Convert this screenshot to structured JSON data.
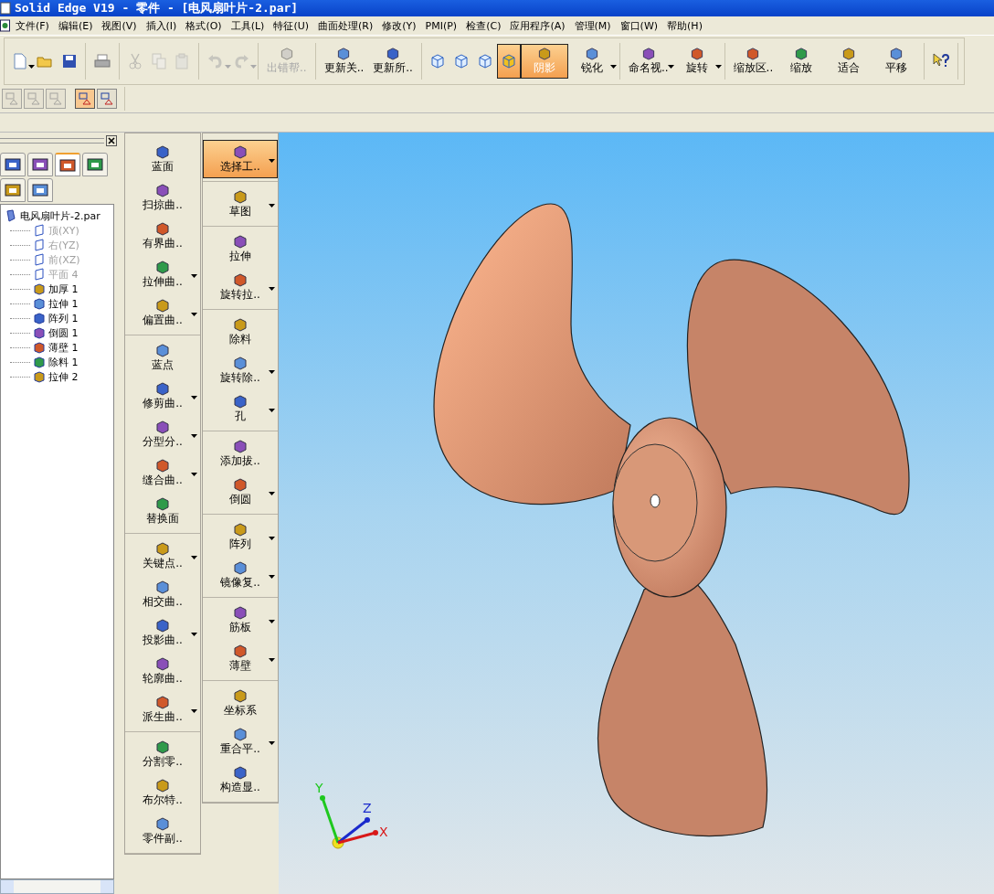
{
  "window": {
    "title": "Solid Edge V19 - 零件 - [电风扇叶片-2.par]"
  },
  "menu": [
    "文件(F)",
    "编辑(E)",
    "视图(V)",
    "插入(I)",
    "格式(O)",
    "工具(L)",
    "特征(U)",
    "曲面处理(R)",
    "修改(Y)",
    "PMI(P)",
    "检查(C)",
    "应用程序(A)",
    "管理(M)",
    "窗口(W)",
    "帮助(H)"
  ],
  "toolbar": [
    [
      {
        "disabled": false,
        "selected": false,
        "dropdown": true
      },
      {
        "disabled": false,
        "selected": false,
        "dropdown": false
      },
      {
        "disabled": false,
        "selected": false,
        "dropdown": false
      }
    ],
    [
      {
        "disabled": false,
        "selected": false,
        "dropdown": false
      }
    ],
    [
      {
        "disabled": true,
        "selected": false,
        "dropdown": false
      },
      {
        "disabled": true,
        "selected": false,
        "dropdown": false
      },
      {
        "disabled": true,
        "selected": false,
        "dropdown": false
      }
    ],
    [
      {
        "disabled": true,
        "selected": false,
        "dropdown": true
      },
      {
        "disabled": true,
        "selected": false,
        "dropdown": true
      }
    ],
    [
      {
        "label": "出错帮..",
        "disabled": true,
        "selected": false,
        "dropdown": false
      }
    ],
    [
      {
        "label": "更新关..",
        "disabled": false,
        "selected": false,
        "dropdown": false
      },
      {
        "label": "更新所..",
        "disabled": false,
        "selected": false,
        "dropdown": false
      }
    ],
    [
      {
        "disabled": false,
        "selected": false,
        "dropdown": false
      },
      {
        "disabled": false,
        "selected": false,
        "dropdown": false
      },
      {
        "disabled": false,
        "selected": false,
        "dropdown": false
      },
      {
        "disabled": false,
        "selected": true,
        "dropdown": false
      },
      {
        "label": "阴影",
        "disabled": false,
        "selected": true,
        "dropdown": false
      },
      {
        "label": "锐化",
        "disabled": false,
        "selected": false,
        "dropdown": true
      }
    ],
    [
      {
        "label": "命名视..",
        "disabled": false,
        "selected": false,
        "dropdown": true
      },
      {
        "label": "旋转",
        "disabled": false,
        "selected": false,
        "dropdown": true
      }
    ],
    [
      {
        "label": "缩放区..",
        "disabled": false,
        "selected": false,
        "dropdown": false
      },
      {
        "label": "缩放",
        "disabled": false,
        "selected": false,
        "dropdown": false
      },
      {
        "label": "适合",
        "disabled": false,
        "selected": false,
        "dropdown": false
      },
      {
        "label": "平移",
        "disabled": false,
        "selected": false,
        "dropdown": false
      }
    ],
    [
      {
        "disabled": false,
        "selected": false,
        "dropdown": false
      }
    ]
  ],
  "toolbar2": [
    [
      {
        "disabled": true,
        "selected": false
      },
      {
        "disabled": true,
        "selected": false
      },
      {
        "disabled": true,
        "selected": false
      }
    ],
    [
      {
        "disabled": false,
        "selected": true
      },
      {
        "disabled": false,
        "selected": false
      }
    ]
  ],
  "edgebar": {
    "tabs": [
      {
        "selected": false
      },
      {
        "selected": false
      },
      {
        "selected": true
      },
      {
        "selected": false
      },
      {
        "selected": false
      },
      {
        "selected": false
      }
    ],
    "tree": {
      "label": "电风扇叶片-2.par",
      "children": [
        {
          "label": "顶(XY)",
          "disabled": true
        },
        {
          "label": "右(YZ)",
          "disabled": true
        },
        {
          "label": "前(XZ)",
          "disabled": true
        },
        {
          "label": "平面 4",
          "disabled": true
        },
        {
          "label": "加厚 1",
          "disabled": false
        },
        {
          "label": "拉伸 1",
          "disabled": false
        },
        {
          "label": "阵列 1",
          "disabled": false
        },
        {
          "label": "倒圆 1",
          "disabled": false
        },
        {
          "label": "薄壁 1",
          "disabled": false
        },
        {
          "label": "除料 1",
          "disabled": false
        },
        {
          "label": "拉伸 2",
          "disabled": false
        }
      ]
    }
  },
  "surface_tools": [
    [
      {
        "label": "蓝面",
        "dropdown": false
      },
      {
        "label": "扫掠曲..",
        "dropdown": false
      },
      {
        "label": "有界曲..",
        "dropdown": false
      },
      {
        "label": "拉伸曲..",
        "dropdown": true
      },
      {
        "label": "偏置曲..",
        "dropdown": true
      }
    ],
    [
      {
        "label": "蓝点",
        "dropdown": false
      },
      {
        "label": "修剪曲..",
        "dropdown": true
      },
      {
        "label": "分型分..",
        "dropdown": true
      },
      {
        "label": "缝合曲..",
        "dropdown": true
      },
      {
        "label": "替换面",
        "dropdown": false
      }
    ],
    [
      {
        "label": "关键点..",
        "dropdown": true
      },
      {
        "label": "相交曲..",
        "dropdown": false
      },
      {
        "label": "投影曲..",
        "dropdown": true
      },
      {
        "label": "轮廓曲..",
        "dropdown": false
      },
      {
        "label": "派生曲..",
        "dropdown": true
      }
    ],
    [
      {
        "label": "分割零..",
        "dropdown": false
      },
      {
        "label": "布尔特..",
        "dropdown": false
      },
      {
        "label": "零件副..",
        "dropdown": false
      }
    ]
  ],
  "feature_tools": [
    [
      {
        "label": "选择工..",
        "dropdown": true,
        "selected": true
      }
    ],
    [
      {
        "label": "草图",
        "dropdown": true,
        "selected": false
      }
    ],
    [
      {
        "label": "拉伸",
        "dropdown": false,
        "selected": false
      },
      {
        "label": "旋转拉..",
        "dropdown": true,
        "selected": false
      }
    ],
    [
      {
        "label": "除料",
        "dropdown": false,
        "selected": false
      },
      {
        "label": "旋转除..",
        "dropdown": true,
        "selected": false
      },
      {
        "label": "孔",
        "dropdown": true,
        "selected": false
      }
    ],
    [
      {
        "label": "添加拔..",
        "dropdown": false,
        "selected": false
      },
      {
        "label": "倒圆",
        "dropdown": true,
        "selected": false
      }
    ],
    [
      {
        "label": "阵列",
        "dropdown": true,
        "selected": false
      },
      {
        "label": "镜像复..",
        "dropdown": true,
        "selected": false
      }
    ],
    [
      {
        "label": "筋板",
        "dropdown": true,
        "selected": false
      },
      {
        "label": "薄壁",
        "dropdown": true,
        "selected": false
      }
    ],
    [
      {
        "label": "坐标系",
        "dropdown": false,
        "selected": false
      },
      {
        "label": "重合平..",
        "dropdown": true,
        "selected": false
      },
      {
        "label": "构造显..",
        "dropdown": false,
        "selected": false
      }
    ]
  ],
  "viewport": {
    "axes": [
      {
        "kind": "y",
        "label": "Y"
      },
      {
        "kind": "z",
        "label": "Z"
      },
      {
        "kind": "x",
        "label": "X"
      }
    ]
  }
}
